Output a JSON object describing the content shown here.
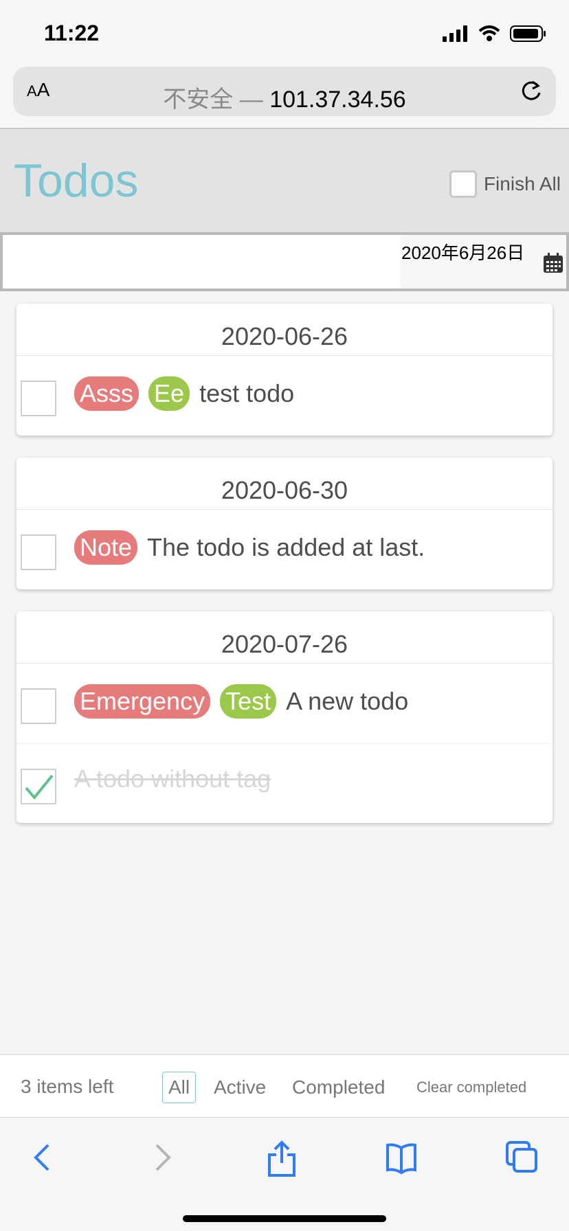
{
  "status_bar": {
    "time": "11:22"
  },
  "browser": {
    "aa_label_small": "A",
    "aa_label_large": "A",
    "url_insecure": "不安全 — ",
    "url_host": "101.37.34.56"
  },
  "app": {
    "title": "Todos",
    "finish_all_label": "Finish All",
    "new_todo_placeholder": "",
    "date_value": "2020年6月26日"
  },
  "groups": [
    {
      "date": "2020-06-26",
      "todos": [
        {
          "tags": [
            {
              "label": "Asss",
              "color": "#e57b7b"
            },
            {
              "label": "Ee",
              "color": "#9bc74a"
            }
          ],
          "text": "test todo",
          "completed": false
        }
      ]
    },
    {
      "date": "2020-06-30",
      "todos": [
        {
          "tags": [
            {
              "label": "Note",
              "color": "#e57b7b"
            }
          ],
          "text": "The todo is added at last.",
          "completed": false
        }
      ]
    },
    {
      "date": "2020-07-26",
      "todos": [
        {
          "tags": [
            {
              "label": "Emergency",
              "color": "#e57b7b"
            },
            {
              "label": "Test",
              "color": "#9bc74a"
            }
          ],
          "text": "A new todo",
          "completed": false
        },
        {
          "tags": [],
          "text": "A todo without tag",
          "completed": true
        }
      ]
    }
  ],
  "footer": {
    "items_left": "3 items left",
    "filters": [
      "All",
      "Active",
      "Completed"
    ],
    "selected_filter": "All",
    "clear_completed": "Clear completed"
  },
  "colors": {
    "title": "#7cc6d1",
    "tag_red": "#e57b7b",
    "tag_green": "#9bc74a",
    "check_green": "#5dc28a",
    "ios_blue": "#2f7cf6"
  }
}
